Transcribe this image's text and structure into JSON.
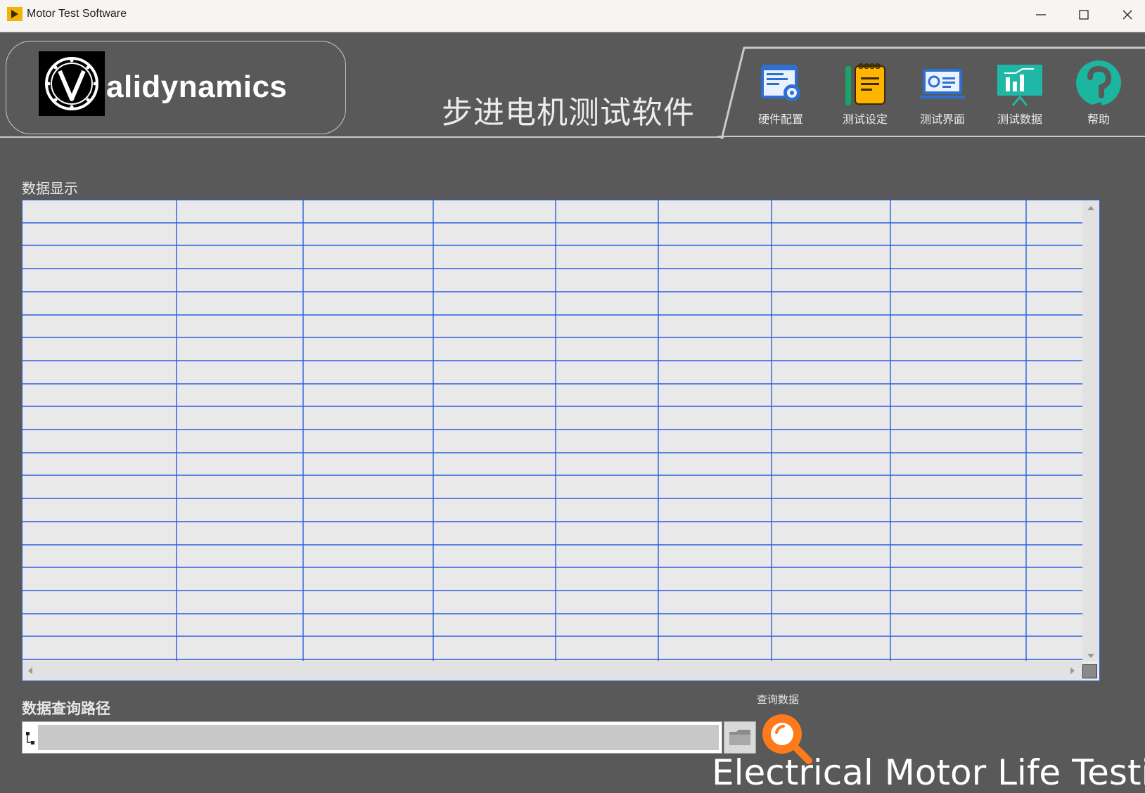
{
  "window": {
    "title": "Motor Test Software",
    "controls": [
      "minimize",
      "maximize",
      "close"
    ]
  },
  "header": {
    "logo_text": "alidynamics",
    "software_title": "步进电机测试软件"
  },
  "toolbar": {
    "items": [
      {
        "label": "硬件配置",
        "icon": "hardware-config-icon"
      },
      {
        "label": "测试设定",
        "icon": "test-settings-icon"
      },
      {
        "label": "测试界面",
        "icon": "test-interface-icon"
      },
      {
        "label": "测试数据",
        "icon": "test-data-icon"
      },
      {
        "label": "帮助",
        "icon": "help-icon"
      }
    ]
  },
  "data_table": {
    "label": "数据显示",
    "columns": 9,
    "rows": 20
  },
  "path": {
    "label": "数据查询路径",
    "value": "",
    "placeholder": ""
  },
  "query": {
    "label": "查询数据"
  },
  "footer": {
    "text": "Electrical Motor Life Testin"
  },
  "colors": {
    "background": "#595959",
    "grid_line": "#2a5ee0",
    "table_bg": "#e9e9e9",
    "query_orange": "#ff7a1a"
  }
}
